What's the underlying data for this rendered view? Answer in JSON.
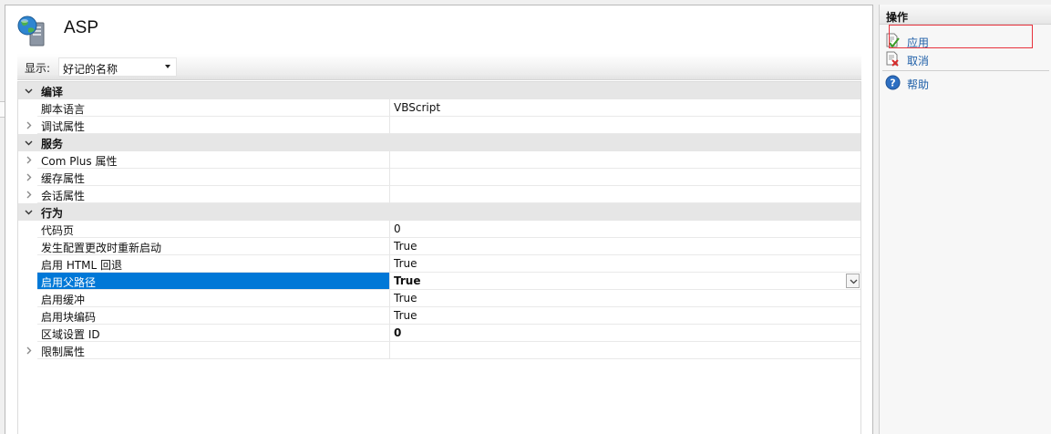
{
  "header": {
    "title": "ASP"
  },
  "display": {
    "label": "显示:",
    "selected": "好记的名称"
  },
  "grid": {
    "rows": [
      {
        "type": "category",
        "name": "编译",
        "expanded": true
      },
      {
        "type": "property",
        "name": "脚本语言",
        "value": "VBScript"
      },
      {
        "type": "property",
        "name": "调试属性",
        "value": "",
        "expandable": true
      },
      {
        "type": "category",
        "name": "服务",
        "expanded": true
      },
      {
        "type": "property",
        "name": "Com Plus 属性",
        "value": "",
        "expandable": true
      },
      {
        "type": "property",
        "name": "缓存属性",
        "value": "",
        "expandable": true
      },
      {
        "type": "property",
        "name": "会话属性",
        "value": "",
        "expandable": true
      },
      {
        "type": "category",
        "name": "行为",
        "expanded": true
      },
      {
        "type": "property",
        "name": "代码页",
        "value": "0"
      },
      {
        "type": "property",
        "name": "发生配置更改时重新启动",
        "value": "True"
      },
      {
        "type": "property",
        "name": "启用 HTML 回退",
        "value": "True"
      },
      {
        "type": "property",
        "name": "启用父路径",
        "value": "True",
        "selected": true,
        "bold": true
      },
      {
        "type": "property",
        "name": "启用缓冲",
        "value": "True"
      },
      {
        "type": "property",
        "name": "启用块编码",
        "value": "True"
      },
      {
        "type": "property",
        "name": "区域设置 ID",
        "value": "0",
        "bold": true
      },
      {
        "type": "property",
        "name": "限制属性",
        "value": "",
        "expandable": true
      }
    ]
  },
  "actions": {
    "title": "操作",
    "items": [
      {
        "label": "应用",
        "icon": "apply-icon"
      },
      {
        "label": "取消",
        "icon": "cancel-icon"
      },
      {
        "label": "帮助",
        "icon": "help-icon"
      }
    ]
  },
  "colors": {
    "selection": "#0078d7",
    "link": "#1f5fa8",
    "category_bg": "#e6e6e6",
    "highlight": "#e8323c"
  }
}
